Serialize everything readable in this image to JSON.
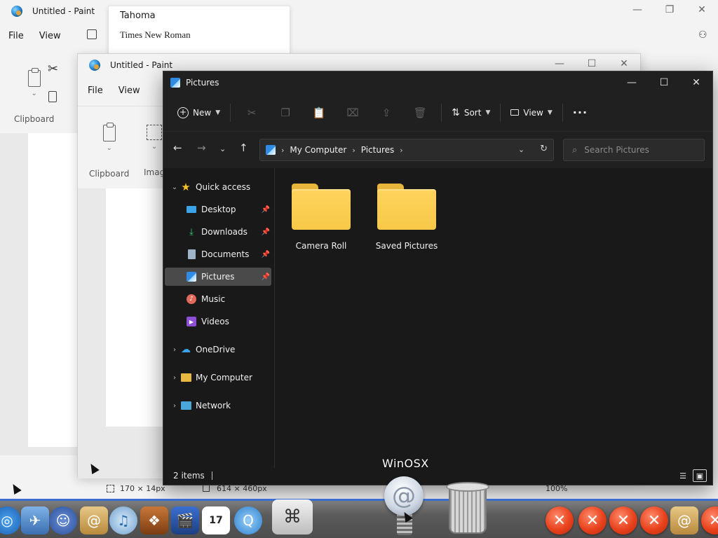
{
  "paint_back": {
    "title": "Untitled - Paint",
    "menu": [
      "File",
      "View"
    ],
    "clipboard_label": "Clipboard",
    "status_selection": "170 × 14px",
    "status_canvas": "614 × 460px",
    "zoom": "100%"
  },
  "font_dropdown": {
    "options": [
      "Tahoma",
      "Times New Roman"
    ]
  },
  "paint_front": {
    "title": "Untitled - Paint",
    "menu": [
      "File",
      "View"
    ],
    "clipboard_label": "Clipboard",
    "image_label_partial": "Imag"
  },
  "explorer": {
    "title": "Pictures",
    "toolbar": {
      "new_label": "New",
      "sort_label": "Sort",
      "view_label": "View",
      "more_label": "···"
    },
    "address": {
      "crumbs": [
        "My Computer",
        "Pictures"
      ]
    },
    "search": {
      "placeholder": "Search Pictures"
    },
    "nav": {
      "quick_access": "Quick access",
      "items": [
        {
          "label": "Desktop",
          "pinned": true
        },
        {
          "label": "Downloads",
          "pinned": true
        },
        {
          "label": "Documents",
          "pinned": true
        },
        {
          "label": "Pictures",
          "pinned": true,
          "selected": true
        },
        {
          "label": "Music",
          "pinned": false
        },
        {
          "label": "Videos",
          "pinned": false
        }
      ],
      "roots": [
        "OneDrive",
        "My Computer",
        "Network"
      ]
    },
    "folders": [
      "Camera Roll",
      "Saved Pictures"
    ],
    "status": {
      "item_count": "2 items"
    }
  },
  "dock": {
    "label": "WinOSX",
    "calendar_day": "17"
  },
  "colors": {
    "explorer_bg": "#191919",
    "folder_yellow": "#ffd35c",
    "dock_accent": "#3a6fd1",
    "close_red": "#e8421c"
  }
}
